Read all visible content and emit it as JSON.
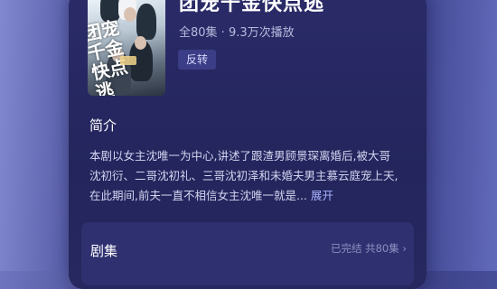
{
  "drama": {
    "title": "团宠千金快点逃",
    "meta": "全80集 · 9.3万次播放",
    "tag": "反转",
    "poster_title": "团宠千金快点逃"
  },
  "synopsis": {
    "heading": "简介",
    "text": "本剧以女主沈唯一为中心,讲述了跟渣男顾景琛离婚后,被大哥沈初衍、二哥沈初礼、三哥沈初泽和未婚夫男主慕云庭宠上天,在此期间,前夫一直不相信女主沈唯一就是...",
    "expand_label": "展开"
  },
  "episodes": {
    "heading": "剧集",
    "status": "已完结 共80集 ›"
  },
  "colors": {
    "panel": "#2a2b68",
    "accent": "#a9b3ff",
    "tag_bg": "#3b3e86"
  }
}
